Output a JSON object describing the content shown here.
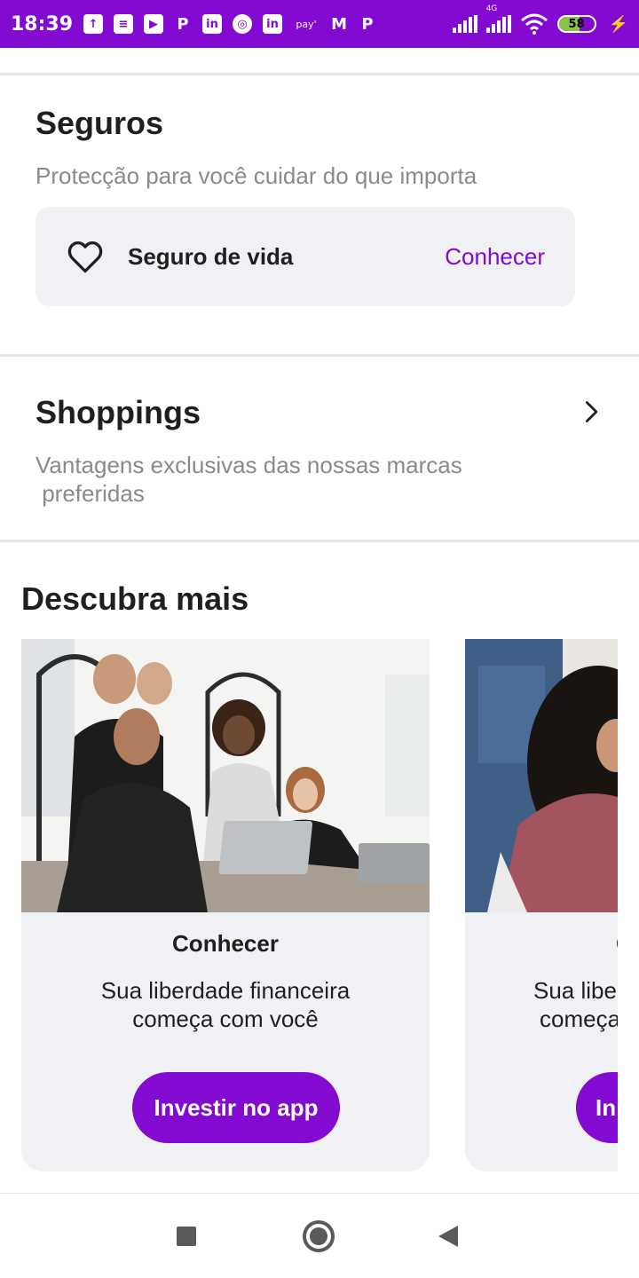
{
  "status_bar": {
    "time": "18:39",
    "battery_level": "58",
    "battery_fraction": 0.58,
    "network_label": "4G",
    "notification_icons": [
      "upload-icon",
      "message-icon",
      "youtube-icon",
      "p-app-icon",
      "linkedin-icon",
      "instagram-icon",
      "linkedin-icon",
      "paytm-icon",
      "gmail-icon",
      "p-app-icon"
    ],
    "pay_label": "pay'"
  },
  "insurance": {
    "title": "Seguros",
    "subtitle": "Protecção para você cuidar do que importa",
    "item_label": "Seguro de vida",
    "item_link": "Conhecer"
  },
  "shopping": {
    "title": "Shoppings",
    "subtitle_line1": "Vantagens exclusivas das nossas marcas",
    "subtitle_line2": " preferidas"
  },
  "discover": {
    "title": "Descubra mais",
    "cards": [
      {
        "title": "Conhecer",
        "desc_line1": "Sua liberdade financeira",
        "desc_line2": "começa com você",
        "button": "Investir no app"
      },
      {
        "title": "C",
        "desc_line1": "Sua libe",
        "desc_line2": "começa",
        "button": "In"
      }
    ]
  },
  "colors": {
    "brand": "#820ad1",
    "card_bg": "#f0f1f5",
    "subtitle": "#8a8a8a"
  }
}
